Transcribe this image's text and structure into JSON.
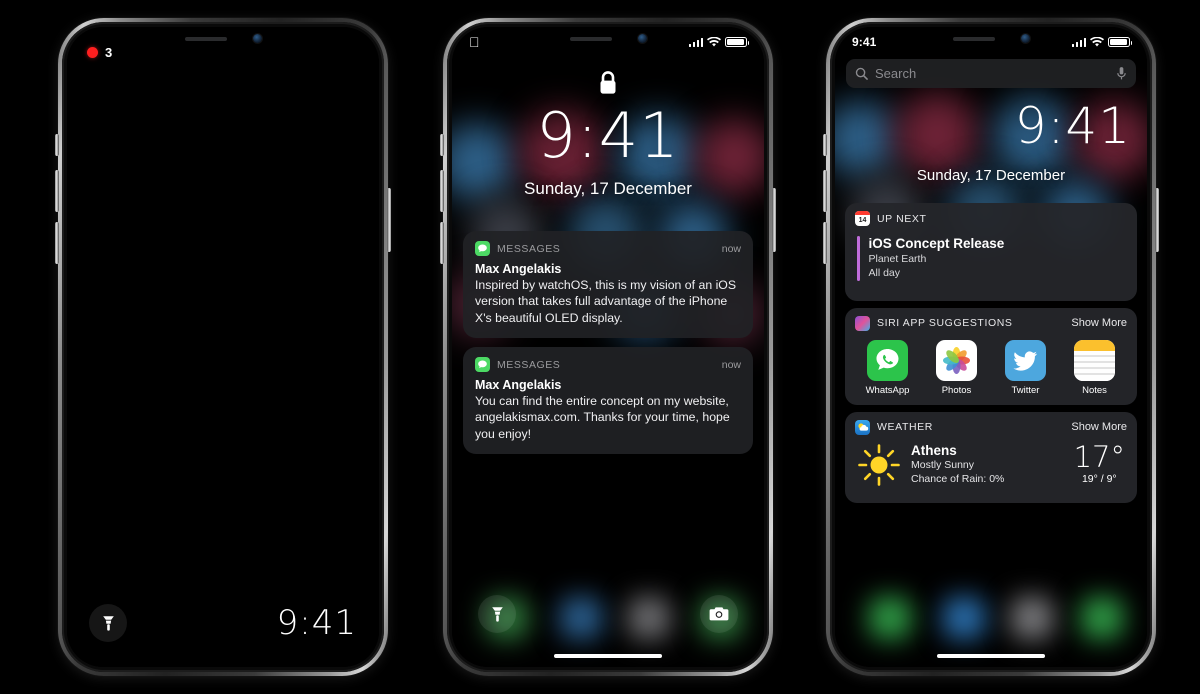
{
  "meta": {
    "scene": "iOS 11 concept — three iPhone X mockups",
    "colors": {
      "accent_purple": "#c06ddb",
      "messages_green": "#4cd964",
      "badge_red": "#ff1f1f",
      "card_bg": "#25262a",
      "notif_bg": "#212225",
      "weather_blue": "#2fa5ee",
      "sun_yellow": "#ffd527"
    }
  },
  "phone1": {
    "name": "locked-dim-screen",
    "badge": {
      "icon": "red-dot-icon",
      "count": "3"
    },
    "flashlight_icon": "flashlight-icon",
    "clock": "9:41",
    "notch": {
      "speaker": "speaker-grille",
      "camera": "front-camera"
    }
  },
  "phone2": {
    "name": "lock-screen",
    "statusbar": {
      "apple_logo": "",
      "signal_icon": "cellular-signal-icon",
      "wifi_icon": "wifi-icon",
      "battery_icon": "battery-icon"
    },
    "lock_icon": "lock-closed-icon",
    "clock": "9:41",
    "date": "Sunday, 17 December",
    "notifications": [
      {
        "app_icon": "messages-icon",
        "app": "MESSAGES",
        "time": "now",
        "title": "Max Angelakis",
        "body": "Inspired by watchOS, this is my vision of an iOS version that takes full advantage of the iPhone X's beautiful OLED display."
      },
      {
        "app_icon": "messages-icon",
        "app": "MESSAGES",
        "time": "now",
        "title": "Max Angelakis",
        "body": "You can find the entire concept on my website, angelakismax.com. Thanks for your time, hope you enjoy!"
      }
    ],
    "shortcuts": {
      "left": "flashlight-icon",
      "right": "camera-icon"
    },
    "home_indicator": "home-indicator"
  },
  "phone3": {
    "name": "today-view",
    "statusbar": {
      "time": "9:41",
      "signal_icon": "cellular-signal-icon",
      "wifi_icon": "wifi-icon",
      "battery_icon": "battery-icon"
    },
    "search": {
      "icon": "search-icon",
      "placeholder": "Search",
      "mic_icon": "microphone-icon"
    },
    "clock": "9:41",
    "date": "Sunday, 17 December",
    "widgets": [
      {
        "id": "up-next",
        "icon": "calendar-icon",
        "icon_day": "14",
        "title": "UP NEXT",
        "more": "",
        "event_title": "iOS Concept Release",
        "event_location": "Planet Earth",
        "event_time": "All day"
      },
      {
        "id": "siri-app-suggestions",
        "icon": "siri-icon",
        "title": "SIRI APP SUGGESTIONS",
        "more": "Show More",
        "apps": [
          {
            "name": "WhatsApp",
            "icon": "whatsapp-icon"
          },
          {
            "name": "Photos",
            "icon": "photos-icon"
          },
          {
            "name": "Twitter",
            "icon": "twitter-icon"
          },
          {
            "name": "Notes",
            "icon": "notes-icon"
          }
        ]
      },
      {
        "id": "weather",
        "icon": "weather-icon",
        "title": "WEATHER",
        "more": "Show More",
        "condition_icon": "sun-icon",
        "city": "Athens",
        "condition": "Mostly Sunny",
        "rain": "Chance of Rain: 0%",
        "temp": "17°",
        "high_low": "19° / 9°"
      }
    ],
    "home_indicator": "home-indicator"
  }
}
